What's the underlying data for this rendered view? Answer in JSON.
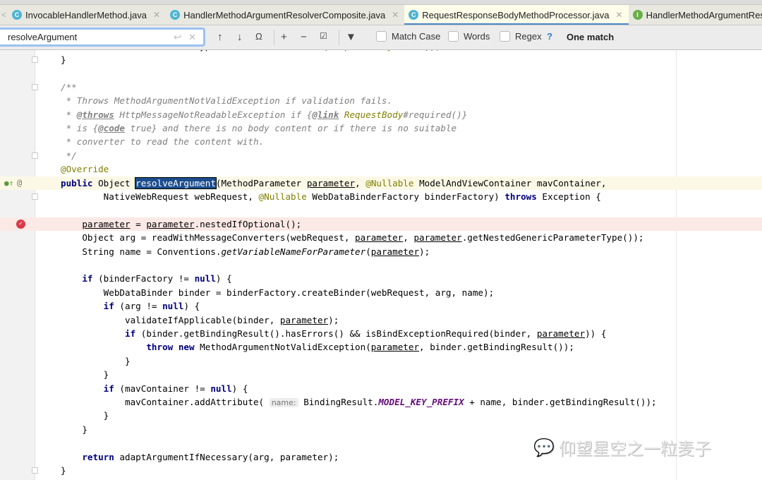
{
  "tabs": [
    {
      "label": "InvocableHandlerMethod.java",
      "icon": "C",
      "active": false
    },
    {
      "label": "HandlerMethodArgumentResolverComposite.java",
      "icon": "C",
      "active": false
    },
    {
      "label": "RequestResponseBodyMethodProcessor.java",
      "icon": "C",
      "active": true
    },
    {
      "label": "HandlerMethodArgumentResolver.java",
      "icon": "I",
      "active": false
    }
  ],
  "search": {
    "query": "resolveArgument",
    "match_case": "Match Case",
    "words": "Words",
    "regex": "Regex",
    "help": "?",
    "result": "One match",
    "match_case_checked": false,
    "words_checked": false,
    "regex_checked": false
  },
  "editor": {
    "lines": [
      [
        [
          "            "
        ],
        [
          "return returnType.hasMethodAnnotation(",
          ""
        ],
        [
          "ResponseBody",
          "ann"
        ],
        [
          ".",
          ""
        ],
        [
          "class",
          "kw"
        ],
        [
          "));",
          ""
        ]
      ],
      [
        [
          "}",
          ""
        ]
      ],
      [],
      [
        [
          "/**",
          "cm"
        ]
      ],
      [
        [
          " * Throws MethodArgumentNotValidException if validation fails.",
          "cm"
        ]
      ],
      [
        [
          " * ",
          "cm"
        ],
        [
          "@throws",
          "tag"
        ],
        [
          " HttpMessageNotReadableException if {",
          "cm"
        ],
        [
          "@link",
          "tag"
        ],
        [
          " RequestBody",
          "lnk"
        ],
        [
          "#required()}",
          "cm"
        ]
      ],
      [
        [
          " * is {",
          "cm"
        ],
        [
          "@code",
          "tag"
        ],
        [
          " true} and there is no body content or if there is no suitable",
          "cm"
        ]
      ],
      [
        [
          " * converter to read the content with.",
          "cm"
        ]
      ],
      [
        [
          " */",
          "cm"
        ]
      ],
      [
        [
          "@Override",
          "ann"
        ]
      ],
      [
        [
          "public",
          "kw"
        ],
        [
          " Object ",
          ""
        ],
        [
          "resolveArgument",
          "sel"
        ],
        [
          "(MethodParameter ",
          ""
        ],
        [
          "parameter",
          "u"
        ],
        [
          ", ",
          ""
        ],
        [
          "@Nullable",
          "ann"
        ],
        [
          " ModelAndViewContainer mavContainer,",
          ""
        ]
      ],
      [
        [
          "        NativeWebRequest webRequest, ",
          ""
        ],
        [
          "@Nullable",
          "ann"
        ],
        [
          " WebDataBinderFactory binderFactory) ",
          ""
        ],
        [
          "throws",
          "kw"
        ],
        [
          " Exception {",
          ""
        ]
      ],
      [],
      [
        [
          "    ",
          ""
        ],
        [
          "parameter",
          "u"
        ],
        [
          " = ",
          ""
        ],
        [
          "parameter",
          "u"
        ],
        [
          ".nestedIfOptional();",
          ""
        ]
      ],
      [
        [
          "    Object arg = readWithMessageConverters(webRequest, ",
          ""
        ],
        [
          "parameter",
          "u"
        ],
        [
          ", ",
          ""
        ],
        [
          "parameter",
          "u"
        ],
        [
          ".getNestedGenericParameterType());",
          ""
        ]
      ],
      [
        [
          "    String name = Conventions.",
          ""
        ],
        [
          "getVariableNameForParameter",
          "sm"
        ],
        [
          "(",
          ""
        ],
        [
          "parameter",
          "u"
        ],
        [
          ");",
          ""
        ]
      ],
      [],
      [
        [
          "    ",
          ""
        ],
        [
          "if",
          "kw"
        ],
        [
          " (binderFactory != ",
          ""
        ],
        [
          "null",
          "kw"
        ],
        [
          ") {",
          ""
        ]
      ],
      [
        [
          "        WebDataBinder binder = binderFactory.createBinder(webRequest, arg, name);",
          ""
        ]
      ],
      [
        [
          "        ",
          ""
        ],
        [
          "if",
          "kw"
        ],
        [
          " (arg != ",
          ""
        ],
        [
          "null",
          "kw"
        ],
        [
          ") {",
          ""
        ]
      ],
      [
        [
          "            validateIfApplicable(binder, ",
          ""
        ],
        [
          "parameter",
          "u"
        ],
        [
          ");",
          ""
        ]
      ],
      [
        [
          "            ",
          ""
        ],
        [
          "if",
          "kw"
        ],
        [
          " (binder.getBindingResult().hasErrors() && isBindExceptionRequired(binder, ",
          ""
        ],
        [
          "parameter",
          "u"
        ],
        [
          ")) {",
          ""
        ]
      ],
      [
        [
          "                ",
          ""
        ],
        [
          "throw new",
          "kw"
        ],
        [
          " MethodArgumentNotValidException(",
          ""
        ],
        [
          "parameter",
          "u"
        ],
        [
          ", binder.getBindingResult());",
          ""
        ]
      ],
      [
        [
          "            }",
          ""
        ]
      ],
      [
        [
          "        }",
          ""
        ]
      ],
      [
        [
          "        ",
          ""
        ],
        [
          "if",
          "kw"
        ],
        [
          " (mavContainer != ",
          ""
        ],
        [
          "null",
          "kw"
        ],
        [
          ") {",
          ""
        ]
      ],
      [
        [
          "            mavContainer.addAttribute( ",
          ""
        ],
        [
          "name:",
          "hint"
        ],
        [
          " BindingResult.",
          ""
        ],
        [
          "MODEL_KEY_PREFIX",
          "fld"
        ],
        [
          " + name, binder.getBindingResult());",
          ""
        ]
      ],
      [
        [
          "        }",
          ""
        ]
      ],
      [
        [
          "    }",
          ""
        ]
      ],
      [],
      [
        [
          "    ",
          ""
        ],
        [
          "return",
          "kw"
        ],
        [
          " adaptArgumentIfNecessary(arg, parameter);",
          ""
        ]
      ],
      [
        [
          "}",
          ""
        ]
      ]
    ]
  },
  "watermark": "仰望星空之一粒麦子"
}
